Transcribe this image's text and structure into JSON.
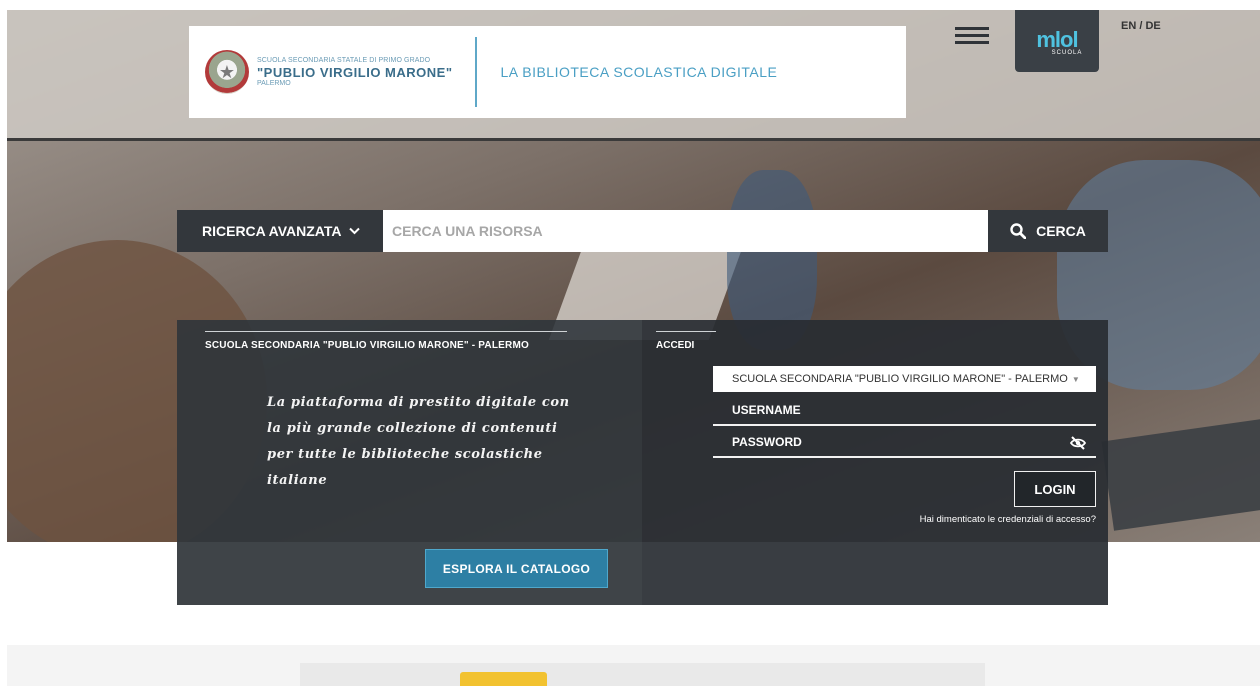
{
  "header": {
    "school_line1": "SCUOLA SECONDARIA STATALE DI PRIMO GRADO",
    "school_name": "\"PUBLIO VIRGILIO MARONE\"",
    "school_city": "PALERMO",
    "tagline": "LA BIBLIOTECA SCOLASTICA DIGITALE",
    "mlol_logo": "mlol",
    "mlol_sub": "SCUOLA",
    "lang_switch": "EN / DE"
  },
  "search": {
    "advanced_label": "RICERCA AVANZATA",
    "placeholder": "CERCA UNA RISORSA",
    "button_label": "CERCA"
  },
  "info": {
    "title": "SCUOLA SECONDARIA \"PUBLIO VIRGILIO MARONE\" - PALERMO",
    "tagline": "La piattaforma di prestito digitale con la più grande collezione di contenuti per tutte le biblioteche scolastiche italiane",
    "explore_button": "ESPLORA IL CATALOGO"
  },
  "login": {
    "title": "ACCEDI",
    "library_selected": "SCUOLA SECONDARIA \"PUBLIO VIRGILIO MARONE\" - PALERMO",
    "username_placeholder": "USERNAME",
    "password_placeholder": "PASSWORD",
    "login_button": "LOGIN",
    "forgot_link": "Hai dimenticato le credenziali di accesso?"
  },
  "colors": {
    "accent": "#2d7fa4",
    "brand_text": "#4a9fc4",
    "panel_dark": "#2e343a",
    "highlight": "#f2c230"
  },
  "icons": {
    "menu": "hamburger-menu-icon",
    "emblem": "italian-republic-emblem-icon",
    "search": "search-icon",
    "chevron": "chevron-down-icon",
    "eye": "eye-slash-icon"
  }
}
